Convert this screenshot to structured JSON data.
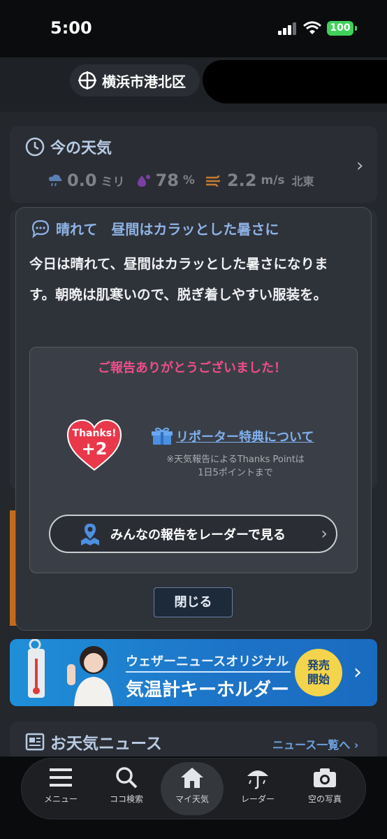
{
  "status": {
    "time": "5:00",
    "battery": "100"
  },
  "header": {
    "location": "横浜市港北区"
  },
  "current": {
    "title": "今の天気",
    "rain_value": "0.0",
    "rain_unit": "ミリ",
    "humidity_value": "78",
    "humidity_unit": "%",
    "wind_value": "2.2",
    "wind_unit": "m/s",
    "wind_dir": "北東"
  },
  "modal": {
    "title": "晴れて　昼間はカラッとした暑さに",
    "body": "今日は晴れて、昼間はカラッとした暑さになります。朝晩は肌寒いので、脱ぎ着しやすい服装を。",
    "thanks_message": "ご報告ありがとうございました！",
    "heart_label": "Thanks!",
    "heart_points": "+2",
    "reporter_link": "リポーター特典について",
    "note_line1": "※天気報告によるThanks Pointは",
    "note_line2": "1日5ポイントまで",
    "radar_button": "みんなの報告をレーダーで見る",
    "close_button": "閉じる"
  },
  "banner": {
    "line1": "ウェザーニュースオリジナル",
    "line2": "気温計キーホルダー",
    "badge_line1": "発売",
    "badge_line2": "開始"
  },
  "news": {
    "title": "お天気ニュース",
    "link": "ニュース一覧へ"
  },
  "tabs": [
    {
      "label": "メニュー",
      "icon": "menu-icon"
    },
    {
      "label": "ココ検索",
      "icon": "search-icon"
    },
    {
      "label": "マイ天気",
      "icon": "home-icon"
    },
    {
      "label": "レーダー",
      "icon": "umbrella-icon"
    },
    {
      "label": "空の写真",
      "icon": "camera-icon"
    }
  ],
  "colors": {
    "accent_pink": "#ee4d8a",
    "link_blue": "#7fb0ee",
    "battery_green": "#3fd15a"
  }
}
